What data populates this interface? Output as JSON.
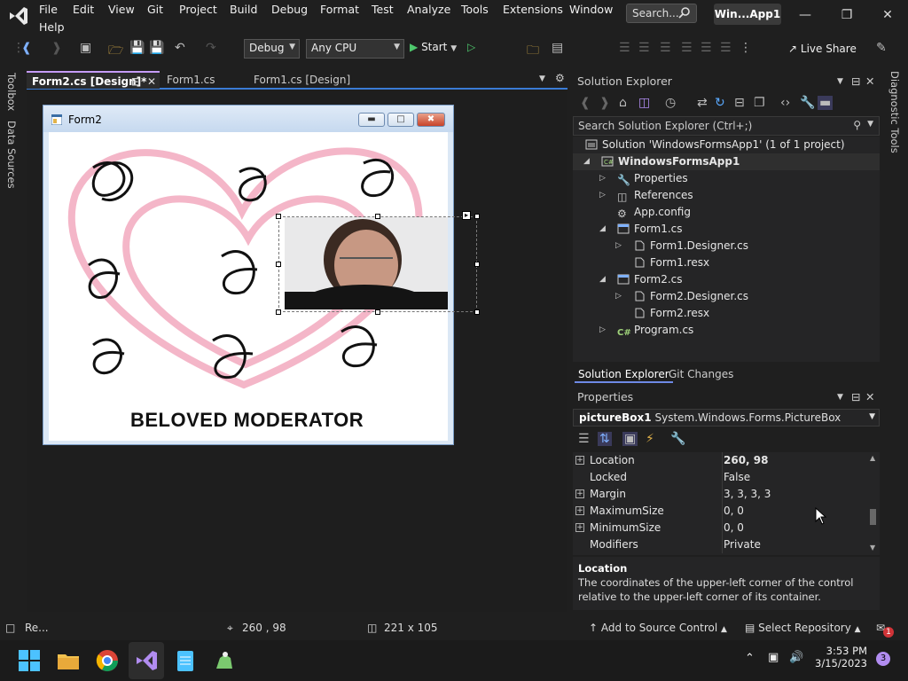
{
  "menubar": {
    "items": [
      "File",
      "Edit",
      "View",
      "Git",
      "Project",
      "Build",
      "Debug",
      "Format",
      "Test",
      "Analyze",
      "Tools",
      "Extensions",
      "Window",
      "Help"
    ],
    "search_label": "Search...",
    "window_title": "Win...App1"
  },
  "toolbar": {
    "config": "Debug",
    "platform": "Any CPU",
    "start_label": "Start",
    "live_share": "Live Share"
  },
  "left_tabs": [
    "Toolbox",
    "Data Sources"
  ],
  "right_tabs": [
    "Diagnostic Tools"
  ],
  "doc_tabs": [
    {
      "label": "Form2.cs [Design]*",
      "active": true
    },
    {
      "label": "Form1.cs",
      "active": false
    },
    {
      "label": "Form1.cs [Design]",
      "active": false
    }
  ],
  "form": {
    "title": "Form2",
    "caption_text": "BELOVED MODERATOR"
  },
  "solution_explorer": {
    "title": "Solution Explorer",
    "search_placeholder": "Search Solution Explorer (Ctrl+;)",
    "tree": [
      {
        "label": "Solution 'WindowsFormsApp1' (1 of 1 project)",
        "indent": 0,
        "expander": "",
        "icon": "solution-icon"
      },
      {
        "label": "WindowsFormsApp1",
        "indent": 1,
        "expander": "open",
        "icon": "csproj-icon",
        "bold": true
      },
      {
        "label": "Properties",
        "indent": 2,
        "expander": "closed",
        "icon": "wrench-icon"
      },
      {
        "label": "References",
        "indent": 2,
        "expander": "closed",
        "icon": "references-icon"
      },
      {
        "label": "App.config",
        "indent": 2,
        "expander": "",
        "icon": "config-icon"
      },
      {
        "label": "Form1.cs",
        "indent": 2,
        "expander": "open",
        "icon": "form-icon"
      },
      {
        "label": "Form1.Designer.cs",
        "indent": 3,
        "expander": "closed",
        "icon": "file-icon"
      },
      {
        "label": "Form1.resx",
        "indent": 3,
        "expander": "",
        "icon": "file-icon"
      },
      {
        "label": "Form2.cs",
        "indent": 2,
        "expander": "open",
        "icon": "form-icon"
      },
      {
        "label": "Form2.Designer.cs",
        "indent": 3,
        "expander": "closed",
        "icon": "file-icon"
      },
      {
        "label": "Form2.resx",
        "indent": 3,
        "expander": "",
        "icon": "file-icon"
      },
      {
        "label": "Program.cs",
        "indent": 2,
        "expander": "closed",
        "icon": "csharp-icon"
      }
    ],
    "tabs": [
      "Solution Explorer",
      "Git Changes"
    ]
  },
  "properties": {
    "title": "Properties",
    "object_name": "pictureBox1",
    "object_type": "System.Windows.Forms.PictureBox",
    "rows": [
      {
        "name": "Location",
        "value": "260, 98",
        "expandable": true,
        "bold": true
      },
      {
        "name": "Locked",
        "value": "False",
        "expandable": false
      },
      {
        "name": "Margin",
        "value": "3, 3, 3, 3",
        "expandable": true
      },
      {
        "name": "MaximumSize",
        "value": "0, 0",
        "expandable": true
      },
      {
        "name": "MinimumSize",
        "value": "0, 0",
        "expandable": true
      },
      {
        "name": "Modifiers",
        "value": "Private",
        "expandable": false
      }
    ],
    "desc_title": "Location",
    "desc_text": "The coordinates of the upper-left corner of the control relative to the upper-left corner of its container."
  },
  "statusbar": {
    "ready": "Re...",
    "position": "260 , 98",
    "size": "221 x 105",
    "add_source": "Add to Source Control",
    "select_repo": "Select Repository",
    "notif_count": "1"
  },
  "taskbar": {
    "time": "3:53 PM",
    "date": "3/15/2023",
    "badge": "3"
  },
  "colors": {
    "accent": "#3a7bd5",
    "vs_purple": "#c59bf7",
    "heart_pink": "#f4b6c8"
  }
}
